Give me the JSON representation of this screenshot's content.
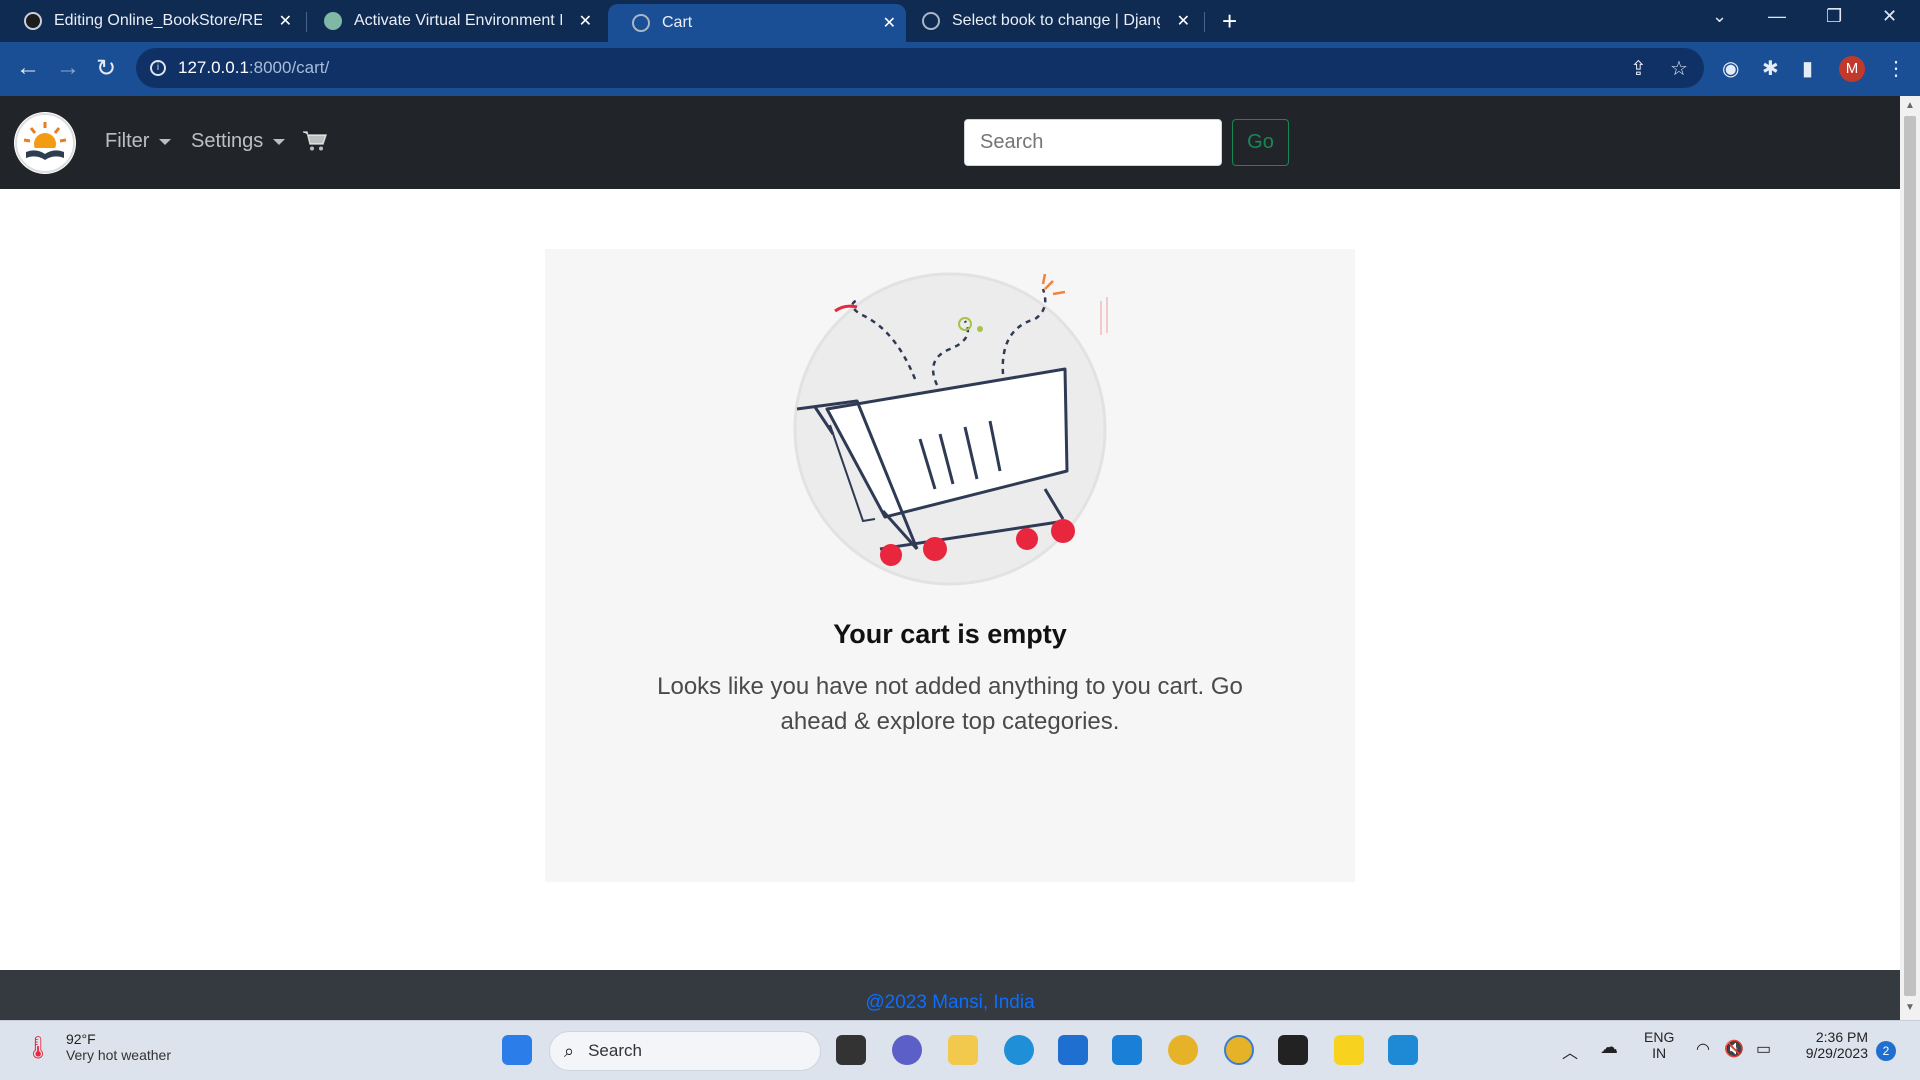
{
  "browser": {
    "tabs": [
      {
        "title": "Editing Online_BookStore/README",
        "icon": "github-icon",
        "active": false
      },
      {
        "title": "Activate Virtual Environment Inst",
        "icon": "chatgpt-icon",
        "active": false
      },
      {
        "title": "Cart",
        "icon": "globe-icon",
        "active": true
      },
      {
        "title": "Select book to change | Django",
        "icon": "globe-icon",
        "active": false
      }
    ],
    "url_host": "127.0.0.1",
    "url_path": ":8000/cart/"
  },
  "navbar": {
    "filter_label": "Filter",
    "settings_label": "Settings",
    "search_placeholder": "Search",
    "go_label": "Go"
  },
  "cart": {
    "title": "Your cart is empty",
    "message": "Looks like you have not added anything to you cart. Go ahead & explore top categories."
  },
  "footer": {
    "text": "@2023 Mansi, India"
  },
  "taskbar": {
    "temperature": "92°F",
    "weather": "Very hot weather",
    "search_label": "Search",
    "language": "ENG",
    "region": "IN",
    "time": "2:36 PM",
    "date": "9/29/2023",
    "notification_count": "2",
    "profile_initial": "M"
  },
  "colors": {
    "navbar_bg": "#212529",
    "go_button": "#198754",
    "footer_link": "#0d6efd",
    "cart_wheel": "#e8273f"
  }
}
